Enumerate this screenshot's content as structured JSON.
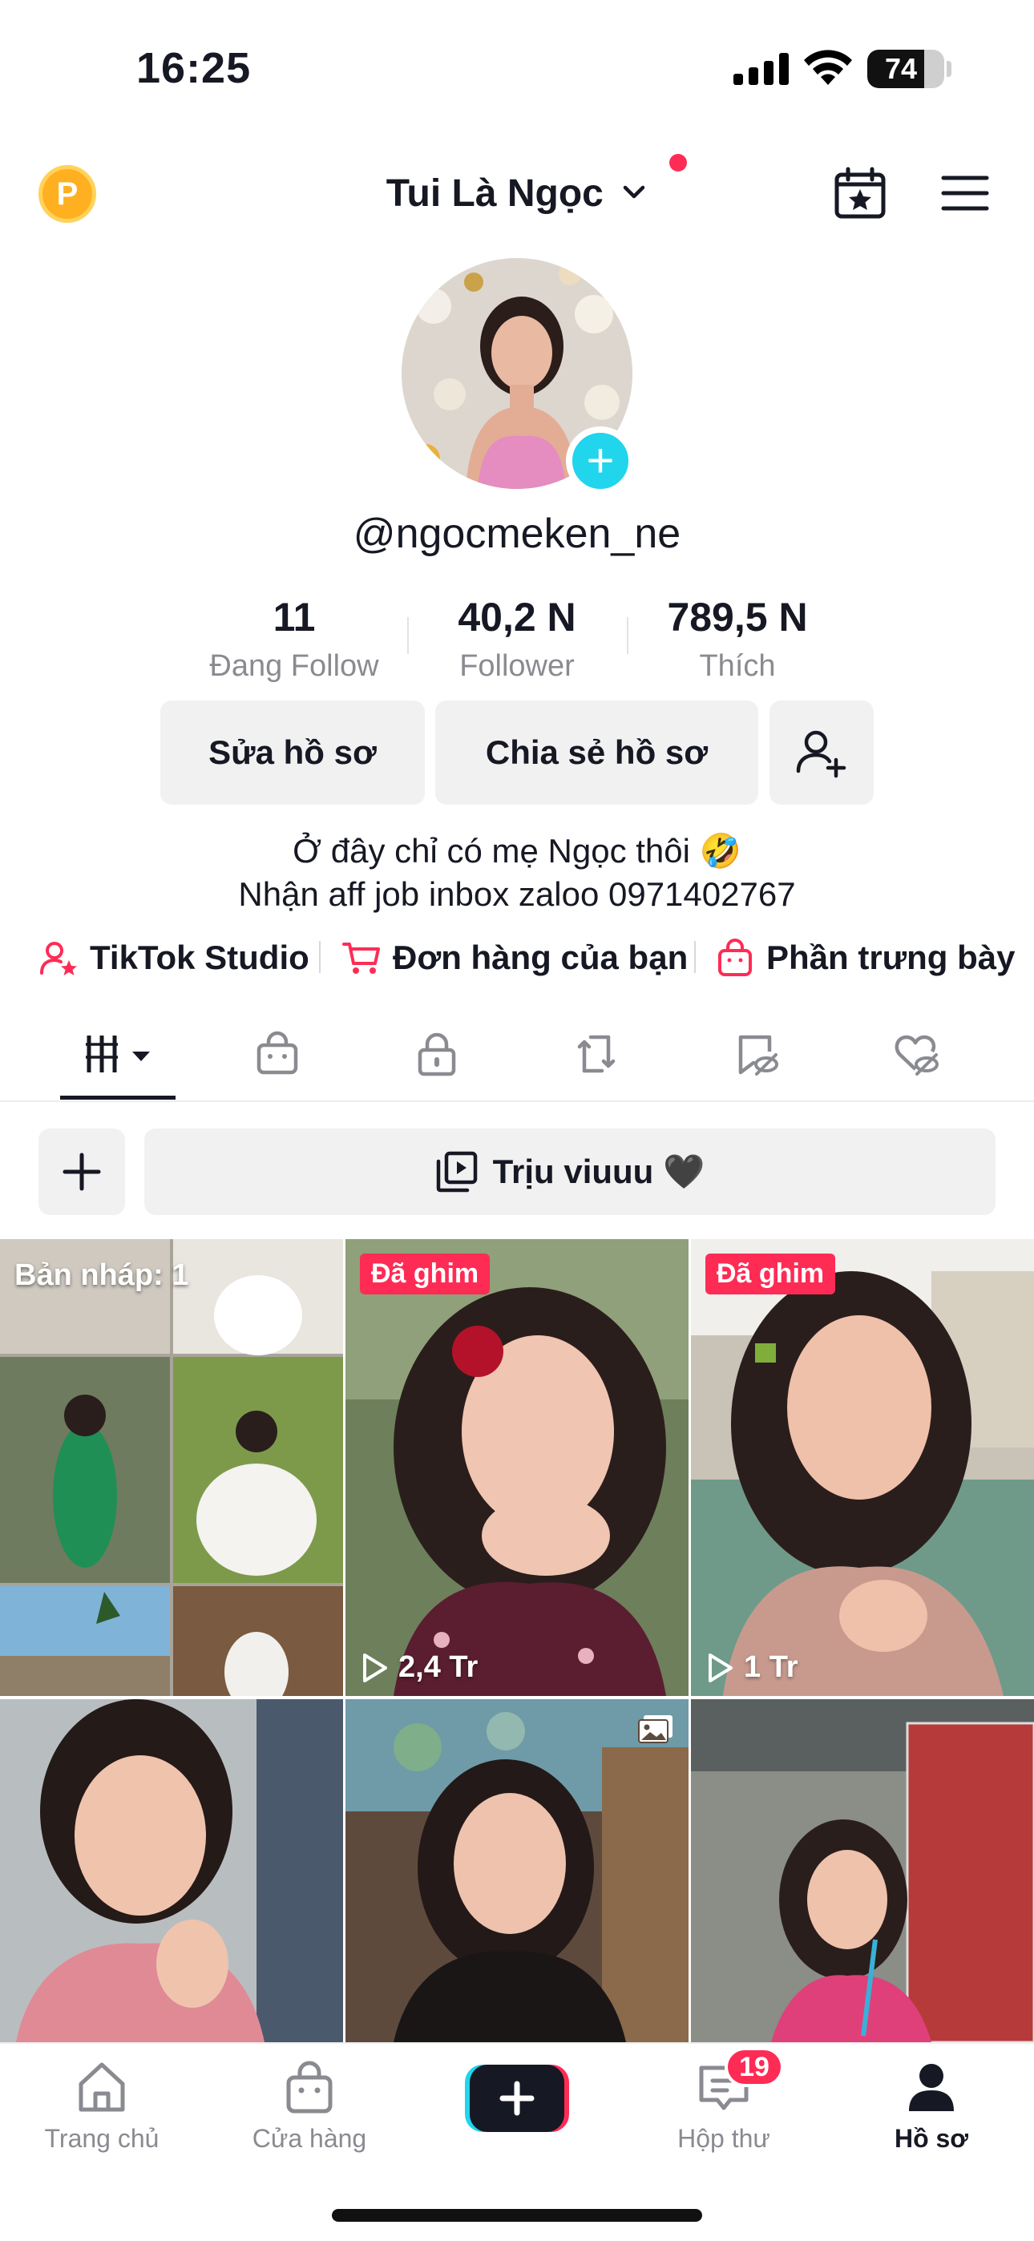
{
  "status_bar": {
    "time": "16:25",
    "battery_percent": 74,
    "battery_text": "74"
  },
  "header": {
    "title": "Tui Là Ngọc",
    "has_notification_dot": true
  },
  "profile": {
    "username": "@ngocmeken_ne",
    "stats": [
      {
        "value": "11",
        "label": "Đang Follow"
      },
      {
        "value": "40,2 N",
        "label": "Follower"
      },
      {
        "value": "789,5 N",
        "label": "Thích"
      }
    ],
    "buttons": {
      "edit": "Sửa hồ sơ",
      "share": "Chia sẻ hồ sơ"
    },
    "bio_line1": "Ở đây chỉ có mẹ Ngọc thôi 🤣",
    "bio_line2": "Nhận aff job inbox zaloo 0971402767"
  },
  "links": [
    {
      "label": "TikTok Studio",
      "icon": "person-star-icon"
    },
    {
      "label": "Đơn hàng của bạn",
      "icon": "cart-icon"
    },
    {
      "label": "Phần trưng bày",
      "icon": "shop-bag-icon"
    }
  ],
  "tabs": [
    {
      "icon": "grid-icon",
      "active": true
    },
    {
      "icon": "shop-icon",
      "active": false
    },
    {
      "icon": "lock-icon",
      "active": false
    },
    {
      "icon": "repost-icon",
      "active": false
    },
    {
      "icon": "bookmark-hidden-icon",
      "active": false
    },
    {
      "icon": "heart-hidden-icon",
      "active": false
    }
  ],
  "collection": {
    "name": "Trịu viuuu 🖤"
  },
  "grid": {
    "draft_label": "Bản nháp: 1",
    "pinned_label": "Đã ghim",
    "items": [
      {
        "views": ""
      },
      {
        "views": "2,4 Tr"
      },
      {
        "views": "1 Tr"
      }
    ]
  },
  "colors": {
    "accent": "#fe2c55",
    "cyan": "#20d5ec",
    "text": "#161823",
    "muted": "#8a8b91"
  },
  "bottom_nav": {
    "home": "Trang chủ",
    "shop": "Cửa hàng",
    "inbox": "Hộp thư",
    "inbox_badge": "19",
    "profile": "Hồ sơ"
  }
}
